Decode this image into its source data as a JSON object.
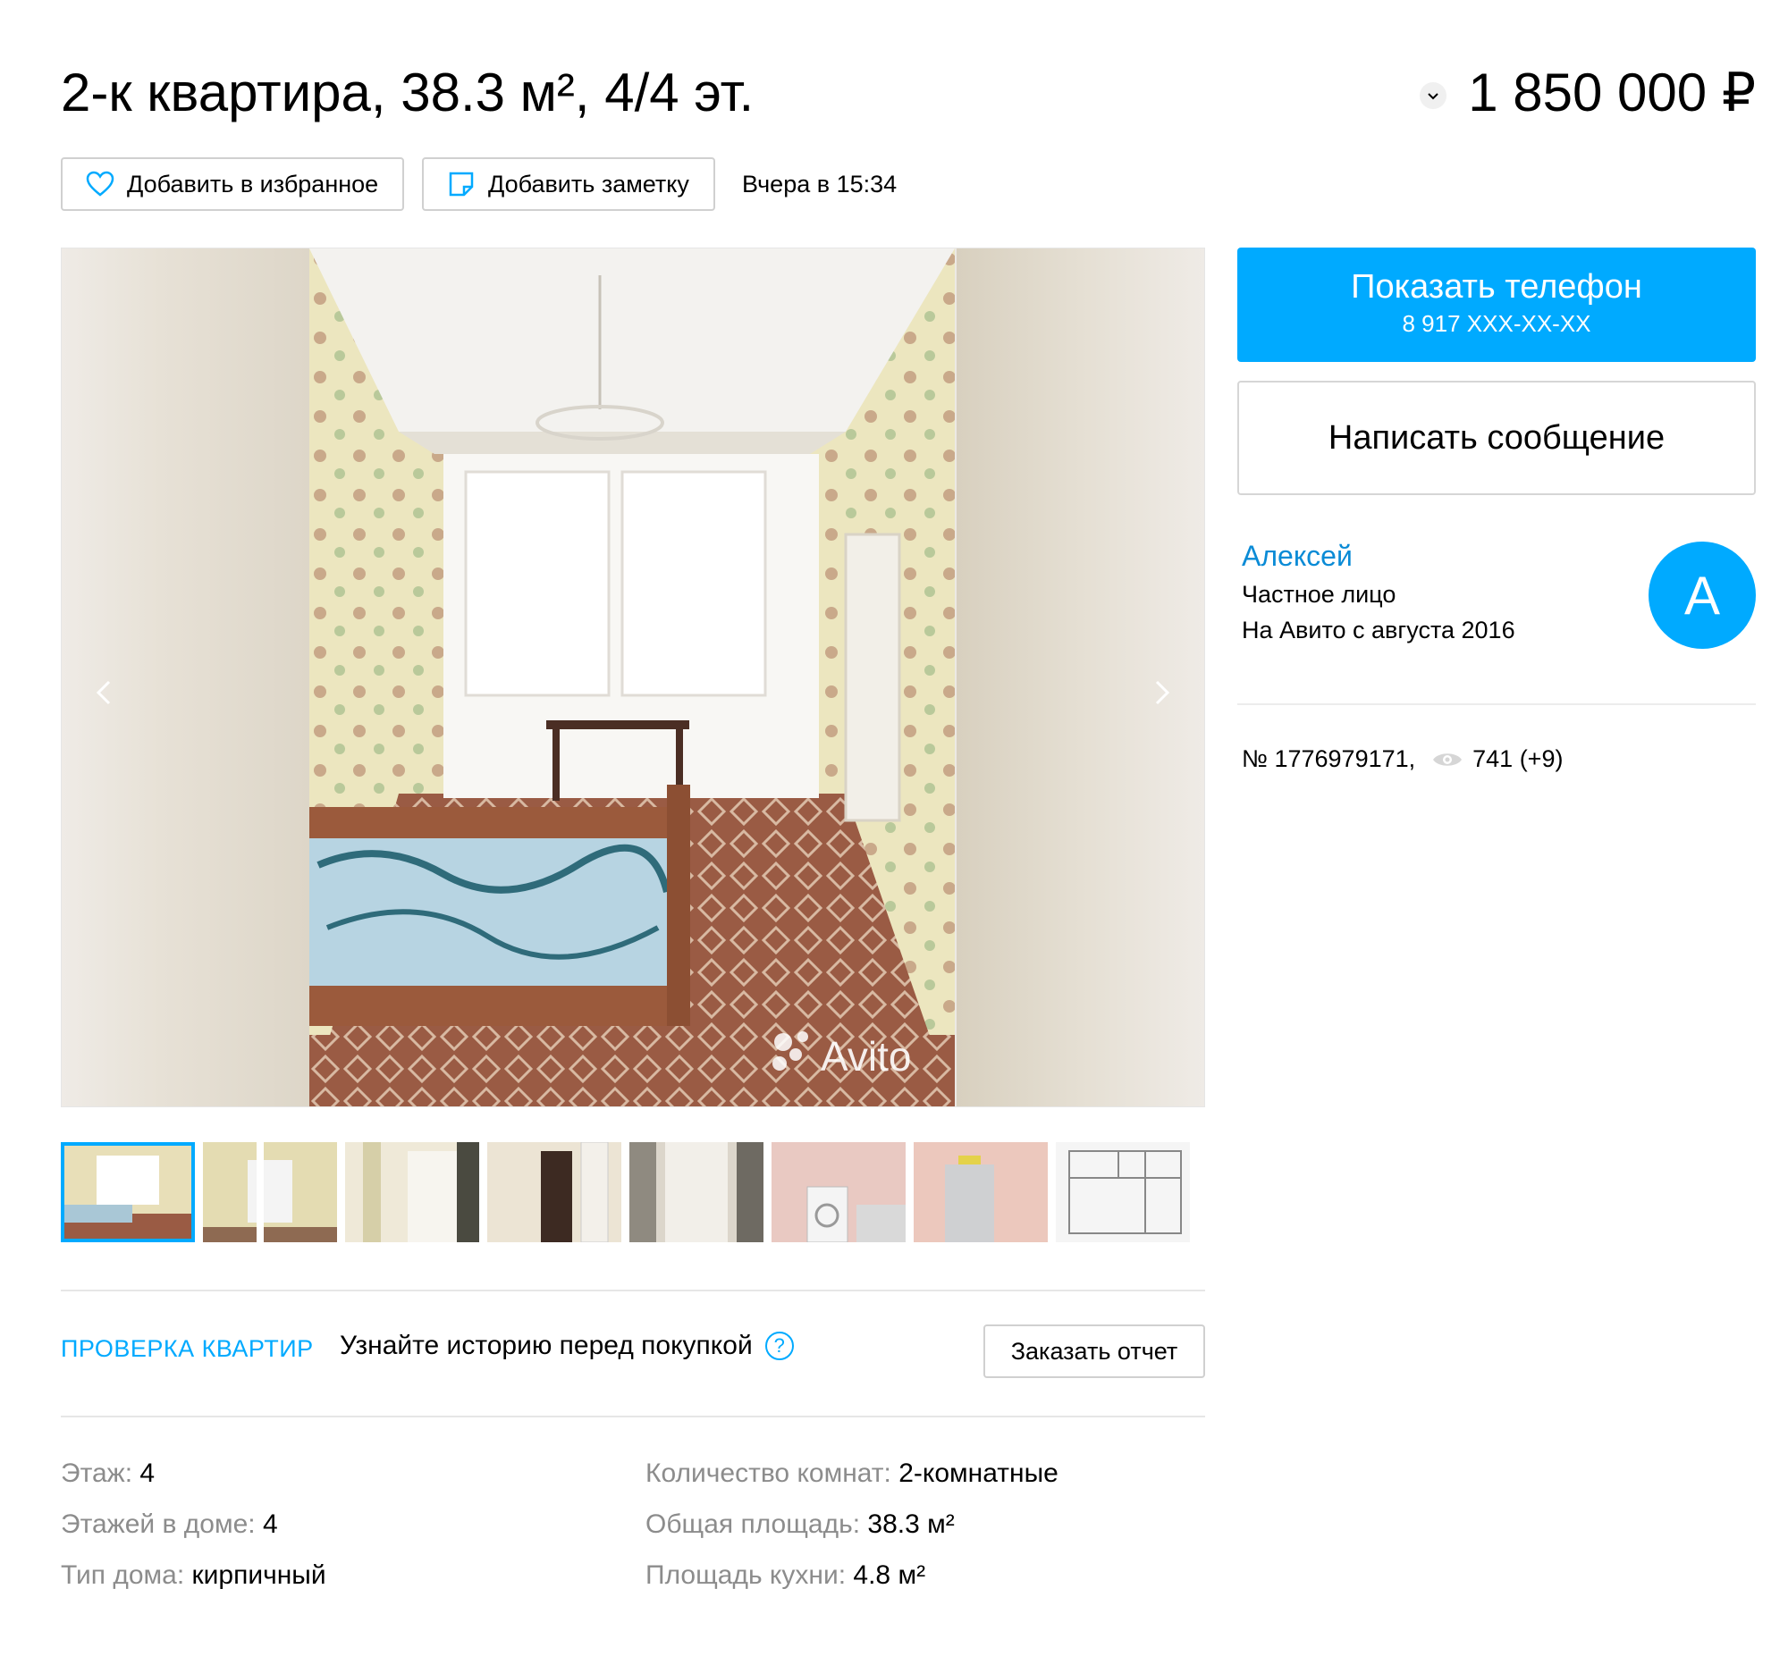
{
  "listing": {
    "title": "2-к квартира, 38.3 м², 4/4 эт.",
    "price": "1 850 000 ₽",
    "favorite_label": "Добавить в избранное",
    "note_label": "Добавить заметку",
    "date": "Вчера в 15:34",
    "watermark": "Avito"
  },
  "gallery": {
    "thumbnails": [
      "bedroom",
      "room-window",
      "room-door",
      "hallway",
      "bathroom-door",
      "kitchen-washer",
      "kitchen-fridge",
      "floor-plan"
    ],
    "active_index": 0
  },
  "check": {
    "label": "ПРОВЕРКА КВАРТИР",
    "text": "Узнайте историю перед покупкой",
    "help": "?",
    "report_button": "Заказать отчет"
  },
  "params": {
    "left": [
      {
        "key": "Этаж:",
        "value": "4"
      },
      {
        "key": "Этажей в доме:",
        "value": "4"
      },
      {
        "key": "Тип дома:",
        "value": "кирпичный"
      }
    ],
    "right": [
      {
        "key": "Количество комнат:",
        "value": "2-комнатные"
      },
      {
        "key": "Общая площадь:",
        "value": "38.3 м²"
      },
      {
        "key": "Площадь кухни:",
        "value": "4.8 м²"
      }
    ]
  },
  "sidebar": {
    "phone_button": "Показать телефон",
    "phone_mask": "8 917 XXX-XX-XX",
    "message_button": "Написать сообщение",
    "seller_name": "Алексей",
    "seller_type": "Частное лицо",
    "seller_since": "На Авито с августа 2016",
    "avatar_letter": "А",
    "ad_number": "№ 1776979171,",
    "views": "741 (+9)"
  },
  "colors": {
    "accent": "#00aaff",
    "link": "#0a8bd6",
    "muted": "#8c8c8c"
  }
}
